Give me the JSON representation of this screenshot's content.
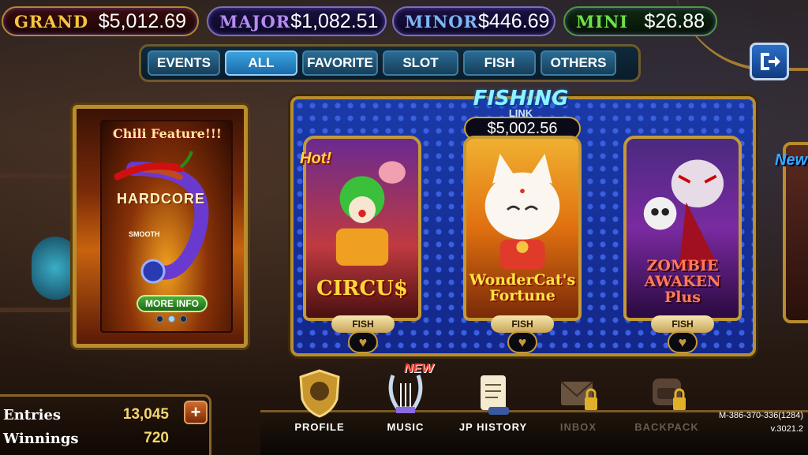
{
  "jackpots": {
    "grand": {
      "label": "GRAND",
      "value": "$5,012.69"
    },
    "major": {
      "label": "MAJOR",
      "value": "$1,082.51"
    },
    "minor": {
      "label": "MINOR",
      "value": "$446.69"
    },
    "mini": {
      "label": "MINI",
      "value": "$26.88"
    }
  },
  "tabs": [
    {
      "label": "EVENTS"
    },
    {
      "label": "ALL",
      "active": true
    },
    {
      "label": "FAVORITE"
    },
    {
      "label": "SLOT"
    },
    {
      "label": "FISH"
    },
    {
      "label": "OTHERS"
    }
  ],
  "promo": {
    "title": "Chili Feature!!!",
    "level_high": "HARDCORE",
    "level_low": "SMOOTH",
    "button": "MORE INFO"
  },
  "fishing_link": {
    "title": "FISHING",
    "subtitle": "LINK",
    "amount": "$5,002.56"
  },
  "games": [
    {
      "name": "CIRCU$",
      "category": "FISH",
      "badge": "Hot!"
    },
    {
      "name": "WonderCat's Fortune",
      "category": "FISH"
    },
    {
      "name": "ZOMBIE AWAKEN Plus",
      "category": "FISH"
    }
  ],
  "side_badge": "New",
  "stats": {
    "entries_label": "Entries",
    "entries_value": "13,045",
    "winnings_label": "Winnings",
    "winnings_value": "720"
  },
  "nav": [
    {
      "label": "PROFILE",
      "icon": "profile-shield-icon"
    },
    {
      "label": "MUSIC",
      "icon": "lyre-icon",
      "badge": "NEW"
    },
    {
      "label": "JP HISTORY",
      "icon": "scroll-icon"
    },
    {
      "label": "INBOX",
      "icon": "envelope-icon",
      "locked": true
    },
    {
      "label": "BACKPACK",
      "icon": "backpack-icon",
      "locked": true
    }
  ],
  "meta": {
    "account": "M-386-370-336(1284)",
    "version": "v.3021.2"
  }
}
